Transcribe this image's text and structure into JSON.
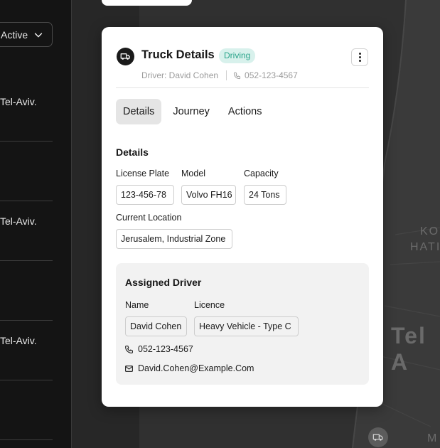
{
  "list": {
    "status_filter": "Active",
    "items": [
      "Tel-Aviv.",
      "Tel-Aviv.",
      "Tel-Aviv."
    ]
  },
  "map": {
    "labels": [
      "KO",
      "HATI",
      "Tel A",
      "M"
    ]
  },
  "card": {
    "title": "Truck Details",
    "status": "Driving",
    "driver_line": "Driver: David Cohen",
    "phone_line": "052-123-4567",
    "tabs": [
      "Details",
      "Journey",
      "Actions"
    ],
    "details": {
      "section_title": "Details",
      "license_label": "License Plate",
      "license_value": "123-456-78",
      "model_label": "Model",
      "model_value": "Volvo FH16",
      "capacity_label": "Capacity",
      "capacity_value": "24 Tons",
      "location_label": "Current Location",
      "location_value": "Jerusalem, Industrial Zone"
    },
    "assigned_driver": {
      "title": "Assigned Driver",
      "name_label": "Name",
      "name_value": "David Cohen",
      "licence_label": "Licence",
      "licence_value": "Heavy Vehicle - Type C",
      "phone": "052-123-4567",
      "email": "David.Cohen@Example.Com"
    }
  },
  "colors": {
    "status_bg": "#d8f1ec",
    "status_text": "#2aa48a",
    "card_bg": "#ffffff",
    "driver_box_bg": "#f2f2f2"
  },
  "icons": [
    "chevron-down-icon",
    "truck-icon",
    "kebab-menu-icon",
    "phone-icon",
    "mail-icon"
  ]
}
